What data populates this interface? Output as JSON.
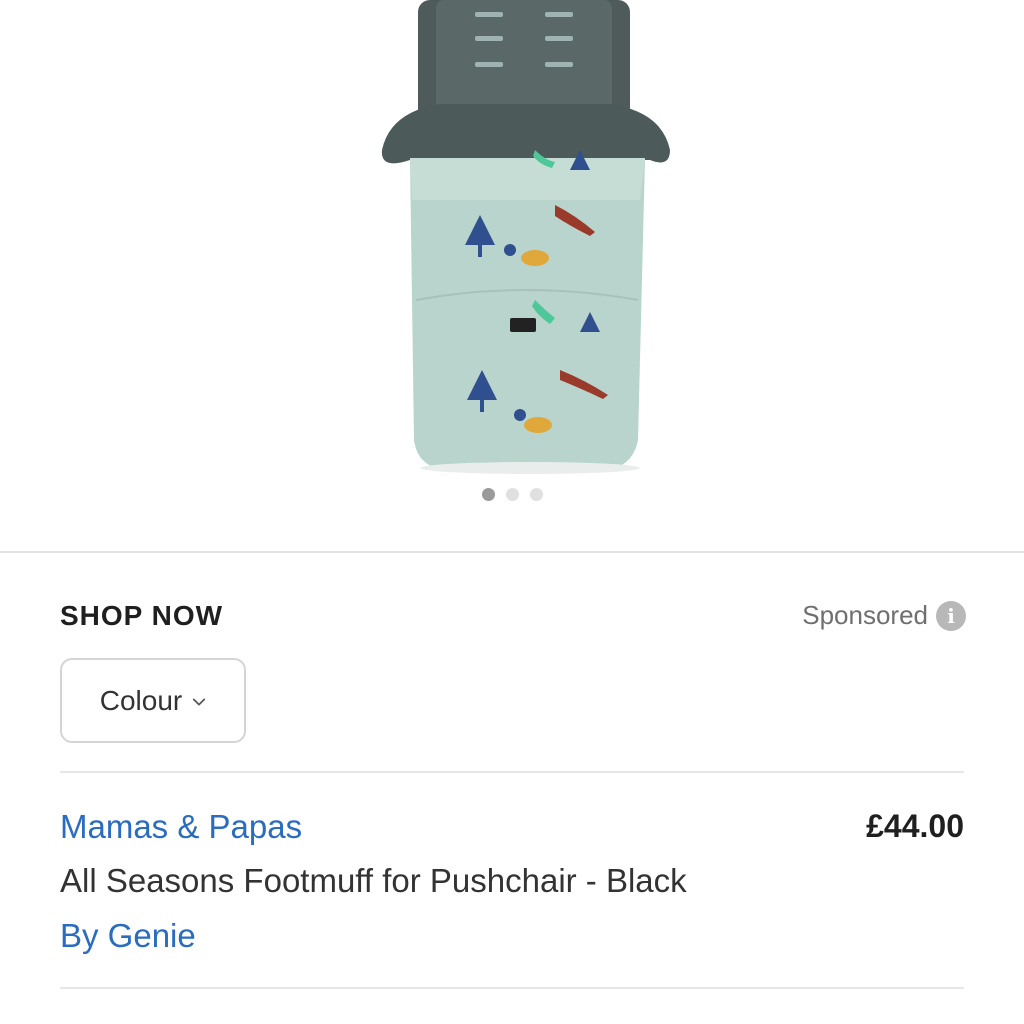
{
  "carousel": {
    "image_name": "footmuff-product-image",
    "pages": 3,
    "active_page": 1
  },
  "shop": {
    "header": "SHOP NOW",
    "sponsored_label": "Sponsored",
    "info_icon": "info-icon",
    "colour_button_label": "Colour",
    "chevron_icon": "chevron-down-icon"
  },
  "product": {
    "brand": "Mamas & Papas",
    "price": "£44.00",
    "title": "All Seasons Footmuff for Pushchair - Black",
    "seller": "By Genie"
  },
  "colors": {
    "link": "#2a6cc0",
    "text": "#222222",
    "muted": "#6f6f6f"
  }
}
